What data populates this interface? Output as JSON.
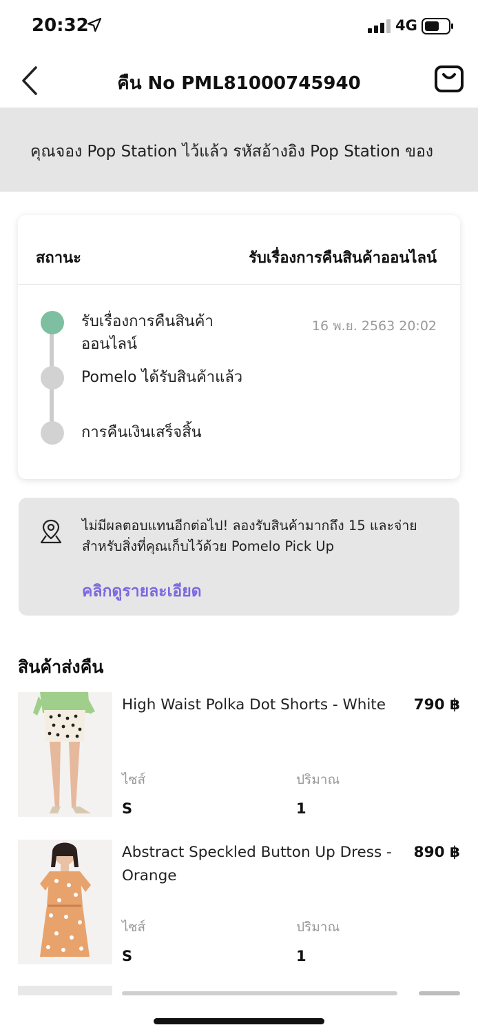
{
  "status_bar": {
    "time": "20:32",
    "network": "4G",
    "location_icon": "location-arrow-icon",
    "signal_icon": "signal-bars-icon",
    "battery_icon": "battery-icon"
  },
  "nav": {
    "title": "คืน No PML81000745940",
    "back_icon": "chevron-left-icon",
    "bag_icon": "shopping-bag-icon"
  },
  "banner": {
    "text": "คุณจอง Pop Station ไว้แล้ว รหัสอ้างอิง Pop Station ของ"
  },
  "status_card": {
    "label": "สถานะ",
    "value": "รับเรื่องการคืนสินค้าออนไลน์",
    "steps": [
      {
        "label": "รับเรื่องการคืนสินค้าออนไลน์",
        "date": "16 พ.ย. 2563 20:02",
        "active": true
      },
      {
        "label": "Pomelo ได้รับสินค้าแล้ว",
        "date": "",
        "active": false
      },
      {
        "label": "การคืนเงินเสร็จสิ้น",
        "date": "",
        "active": false
      }
    ],
    "colors": {
      "active": "#7dbfa0",
      "inactive": "#d2d2d2"
    }
  },
  "promo": {
    "icon": "map-pin-icon",
    "text": "ไม่มีผลตอบแทนอีกต่อไป! ลองรับสินค้ามากถึง 15 และจ่ายสำหรับสิ่งที่คุณเก็บไว้ด้วย Pomelo Pick Up",
    "link": "คลิกดูรายละเอียด",
    "link_color": "#7d68e0"
  },
  "products_section": {
    "title": "สินค้าส่งคืน",
    "size_label": "ไซส์",
    "qty_label": "ปริมาณ",
    "items": [
      {
        "name": "High Waist Polka Dot Shorts - White",
        "price": "790 ฿",
        "size": "S",
        "qty": "1"
      },
      {
        "name": "Abstract Speckled Button Up Dress - Orange",
        "price": "890 ฿",
        "size": "S",
        "qty": "1"
      }
    ]
  }
}
